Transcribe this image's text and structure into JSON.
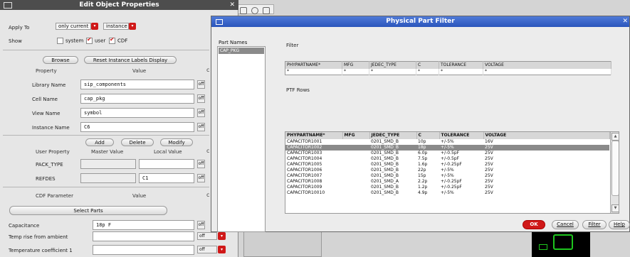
{
  "eop": {
    "title": "Edit Object Properties",
    "apply_to_label": "Apply To",
    "apply_to_value": "only current",
    "apply_to_scope": "instance",
    "show_label": "Show",
    "show_options": [
      {
        "label": "system",
        "checked": false
      },
      {
        "label": "user",
        "checked": true
      },
      {
        "label": "CDF",
        "checked": true
      }
    ],
    "browse_label": "Browse",
    "reset_label": "Reset Instance Labels Display",
    "property_header": "Property",
    "value_header": "Value",
    "props": [
      {
        "name": "Library Name",
        "value": "sip_components"
      },
      {
        "name": "Cell Name",
        "value": "cap_pkg"
      },
      {
        "name": "View Name",
        "value": "symbol"
      },
      {
        "name": "Instance Name",
        "value": "C6"
      }
    ],
    "add_label": "Add",
    "delete_label": "Delete",
    "modify_label": "Modify",
    "user_property_header": "User Property",
    "master_value_header": "Master Value",
    "local_value_header": "Local Value",
    "user_props": [
      {
        "name": "PACK_TYPE",
        "master": "",
        "local": ""
      },
      {
        "name": "REFDES",
        "master": "",
        "local": "C1"
      }
    ],
    "cdf_parameter_header": "CDF Parameter",
    "cdf_value_header": "Value",
    "select_parts_label": "Select Parts",
    "cdf_params": [
      {
        "name": "Capacitance",
        "value": "18p F"
      },
      {
        "name": "Temp rise from ambient",
        "value": ""
      },
      {
        "name": "Temperature coefficient 1",
        "value": ""
      }
    ],
    "off_label": "off"
  },
  "bg": {
    "tool_count": "1"
  },
  "ppf": {
    "title": "Physical Part Filter",
    "part_names_label": "Part Names",
    "part_names": [
      "CAP_PKG"
    ],
    "filter_label": "Filter",
    "ptf_rows_label": "PTF Rows",
    "columns": [
      "PHYPARTNAME*",
      "MFG",
      "JEDEC_TYPE",
      "C",
      "TOLERANCE",
      "VOLTAGE"
    ],
    "filter_values": [
      "*",
      "*",
      "*",
      "*",
      "*",
      "*"
    ],
    "rows": [
      [
        "CAPACITOR1001",
        "",
        "0201_SMD_B",
        "10p",
        "+/-5%",
        "16V"
      ],
      [
        "CAPACITOR1002",
        "",
        "0201_SMD_B",
        "18p",
        "+/-5%",
        "25V"
      ],
      [
        "CAPACITOR1003",
        "",
        "0201_SMD_B",
        "6.0p",
        "+/-0.5pF",
        "25V"
      ],
      [
        "CAPACITOR1004",
        "",
        "0201_SMD_B",
        "7.5p",
        "+/-0.5pF",
        "25V"
      ],
      [
        "CAPACITOR1005",
        "",
        "0201_SMD_B",
        "1.6p",
        "+/-0.25pF",
        "25V"
      ],
      [
        "CAPACITOR1006",
        "",
        "0201_SMD_B",
        "22p",
        "+/-5%",
        "25V"
      ],
      [
        "CAPACITOR1007",
        "",
        "0201_SMD_B",
        "15p",
        "+/-5%",
        "25V"
      ],
      [
        "CAPACITOR1008",
        "",
        "0201_SMD_A",
        "2.2p",
        "+/-0.25pF",
        "25V"
      ],
      [
        "CAPACITOR1009",
        "",
        "0201_SMD_B",
        "1.2p",
        "+/-0.25pF",
        "25V"
      ],
      [
        "CAPACITOR10010",
        "",
        "0201_SMD_B",
        "4.9p",
        "+/-5%",
        "25V"
      ]
    ],
    "selected_row_index": 1,
    "buttons": {
      "ok": "OK",
      "cancel": "Cancel",
      "filter": "Filter",
      "help": "Help"
    },
    "accent_color": "#2a55bb",
    "ok_color": "#d01818"
  }
}
